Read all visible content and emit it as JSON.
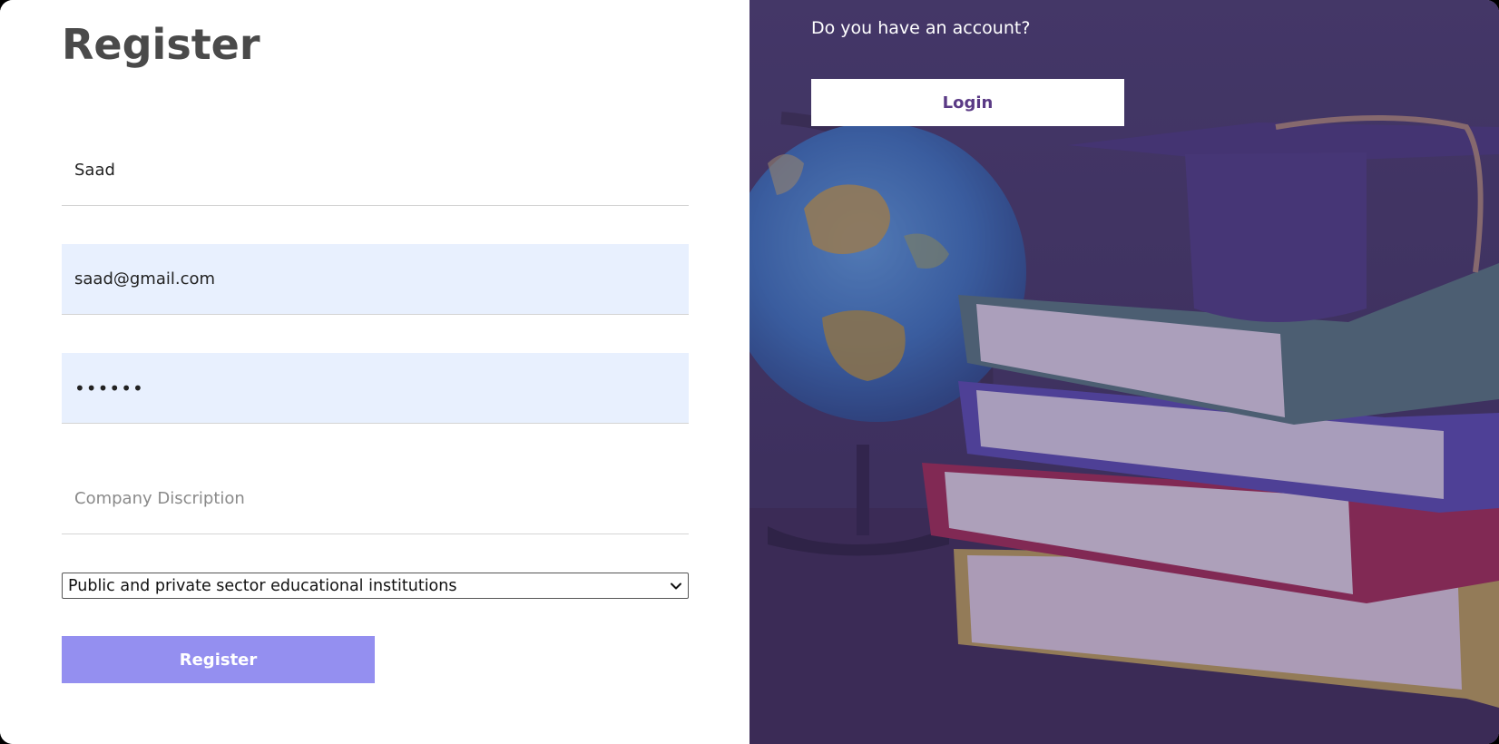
{
  "form": {
    "title": "Register",
    "name_value": "Saad",
    "email_value": "saad@gmail.com",
    "password_value": "••••••",
    "description_placeholder": "Company Discription",
    "sector_selected": "Public and private sector educational institutions",
    "register_label": "Register"
  },
  "side": {
    "question": "Do you have an account?",
    "login_label": "Login"
  },
  "colors": {
    "register_button": "#948ff0",
    "autofill_background": "#e8f0fe",
    "overlay": "#3e3058",
    "login_text": "#5a3a85"
  },
  "icons": {
    "select_arrow": "chevron-down-icon"
  }
}
